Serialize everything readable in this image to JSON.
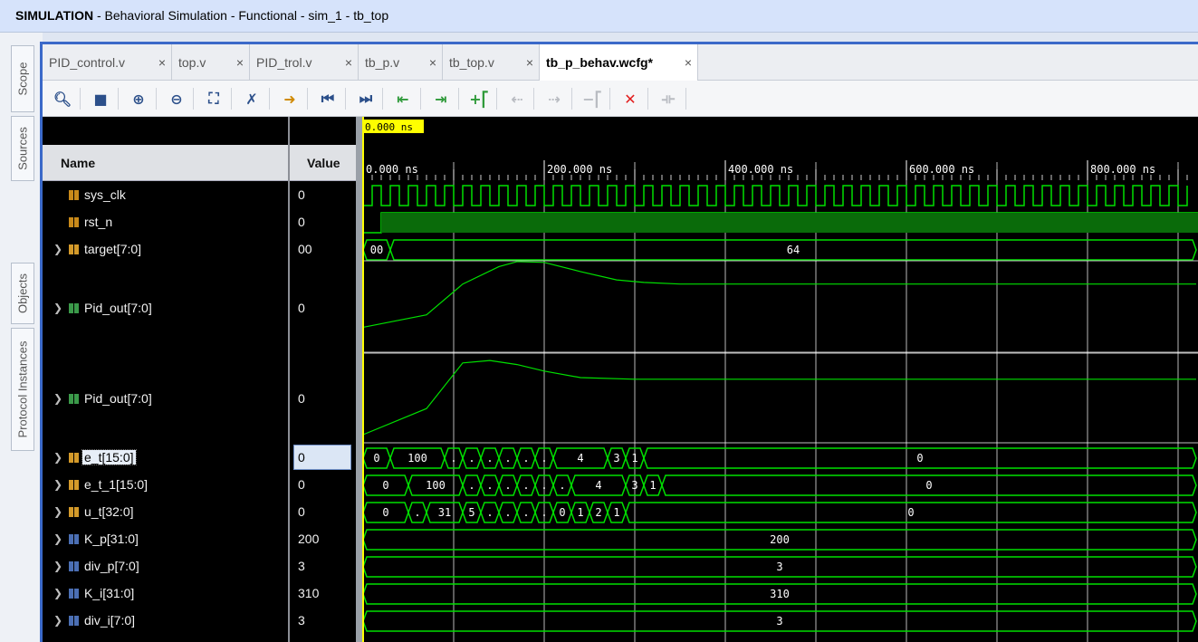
{
  "title": {
    "mode": "SIMULATION",
    "rest": " - Behavioral Simulation - Functional - sim_1 - tb_top"
  },
  "side_tabs": [
    "Scope",
    "Sources",
    "Objects",
    "Protocol Instances"
  ],
  "tabs": [
    {
      "label": "PID_control.v",
      "close": "×"
    },
    {
      "label": "top.v",
      "close": "×"
    },
    {
      "label": "PID_trol.v",
      "close": "×"
    },
    {
      "label": "tb_p.v",
      "close": "×"
    },
    {
      "label": "tb_top.v",
      "close": "×"
    },
    {
      "label": "tb_p_behav.wcfg*",
      "close": "×",
      "active": true
    }
  ],
  "toolbar": [
    {
      "name": "search-icon",
      "glyph": "🔍︎",
      "color": "#2b4f8a"
    },
    {
      "name": "save-icon",
      "glyph": "■",
      "color": "#2b4f8a"
    },
    {
      "name": "zoom-in-icon",
      "glyph": "⊕",
      "color": "#2b4f8a"
    },
    {
      "name": "zoom-out-icon",
      "glyph": "⊖",
      "color": "#2b4f8a"
    },
    {
      "name": "zoom-fit-icon",
      "glyph": "⛶",
      "color": "#2b4f8a"
    },
    {
      "name": "cursor-icon",
      "glyph": "✗",
      "color": "#2b4f8a"
    },
    {
      "name": "goto-cursor-icon",
      "glyph": "➜",
      "color": "#d08a00"
    },
    {
      "name": "go-to-start-icon",
      "glyph": "⏮",
      "color": "#2b4f8a"
    },
    {
      "name": "go-to-end-icon",
      "glyph": "⏭",
      "color": "#2b4f8a"
    },
    {
      "name": "previous-transition-icon",
      "glyph": "⇤",
      "color": "#2f9a3a"
    },
    {
      "name": "next-transition-icon",
      "glyph": "⇥",
      "color": "#2f9a3a"
    },
    {
      "name": "add-marker-icon",
      "glyph": "+⎡",
      "color": "#2f9a3a"
    },
    {
      "name": "previous-marker-icon",
      "glyph": "⇠",
      "color": "#b9bcc2"
    },
    {
      "name": "next-marker-icon",
      "glyph": "⇢",
      "color": "#b9bcc2"
    },
    {
      "name": "delete-marker-icon",
      "glyph": "−⎡",
      "color": "#b9bcc2"
    },
    {
      "name": "delete-icon",
      "glyph": "✕",
      "color": "#e21d1d"
    },
    {
      "name": "swap-cursors-icon",
      "glyph": "⟛",
      "color": "#b9bcc2"
    }
  ],
  "columns": {
    "name": "Name",
    "value": "Value"
  },
  "signals": [
    {
      "name": "sys_clk",
      "value": "0",
      "expandable": false,
      "icon": "bit"
    },
    {
      "name": "rst_n",
      "value": "0",
      "expandable": false,
      "icon": "bit"
    },
    {
      "name": "target[7:0]",
      "value": "00",
      "expandable": true,
      "icon": "bus-orange"
    },
    {
      "name": "Pid_out[7:0]",
      "value": "0",
      "expandable": true,
      "icon": "bus-green"
    },
    {
      "name": "Pid_out[7:0]",
      "value": "0",
      "expandable": true,
      "icon": "bus-green"
    },
    {
      "name": "e_t[15:0]",
      "value": "0",
      "expandable": true,
      "icon": "bus-orange",
      "selected": true
    },
    {
      "name": "e_t_1[15:0]",
      "value": "0",
      "expandable": true,
      "icon": "bus-orange"
    },
    {
      "name": "u_t[32:0]",
      "value": "0",
      "expandable": true,
      "icon": "bus-orange"
    },
    {
      "name": "K_p[31:0]",
      "value": "200",
      "expandable": true,
      "icon": "bus-blue"
    },
    {
      "name": "div_p[7:0]",
      "value": "3",
      "expandable": true,
      "icon": "bus-blue"
    },
    {
      "name": "K_i[31:0]",
      "value": "310",
      "expandable": true,
      "icon": "bus-blue"
    },
    {
      "name": "div_i[7:0]",
      "value": "3",
      "expandable": true,
      "icon": "bus-blue"
    }
  ],
  "waveform": {
    "cursor_label": "0.000 ns",
    "time_labels": [
      "0.000 ns",
      "200.000 ns",
      "400.000 ns",
      "600.000 ns",
      "800.000 ns"
    ],
    "time_range_ns": [
      0,
      920
    ],
    "clock_period_ns": 20,
    "rst_release_ns": 20,
    "colors": {
      "signal": "#00e000",
      "bus_fill": "#0a6b0a",
      "grid": "#ffffff",
      "cursor": "#ffff00",
      "text": "#ffffff"
    },
    "buses": {
      "target": [
        {
          "t0": 0,
          "t1": 30,
          "label": "00"
        },
        {
          "t0": 30,
          "t1": 920,
          "label": "64"
        }
      ],
      "e_t": [
        {
          "t0": 0,
          "t1": 30,
          "label": "0"
        },
        {
          "t0": 30,
          "t1": 90,
          "label": "100"
        },
        {
          "t0": 90,
          "t1": 110,
          "label": "."
        },
        {
          "t0": 110,
          "t1": 130,
          "label": "."
        },
        {
          "t0": 130,
          "t1": 150,
          "label": "."
        },
        {
          "t0": 150,
          "t1": 170,
          "label": "."
        },
        {
          "t0": 170,
          "t1": 190,
          "label": "."
        },
        {
          "t0": 190,
          "t1": 210,
          "label": "."
        },
        {
          "t0": 210,
          "t1": 270,
          "label": "4"
        },
        {
          "t0": 270,
          "t1": 290,
          "label": "3"
        },
        {
          "t0": 290,
          "t1": 310,
          "label": "1"
        },
        {
          "t0": 310,
          "t1": 920,
          "label": "0"
        }
      ],
      "e_t_1": [
        {
          "t0": 0,
          "t1": 50,
          "label": "0"
        },
        {
          "t0": 50,
          "t1": 110,
          "label": "100"
        },
        {
          "t0": 110,
          "t1": 130,
          "label": "."
        },
        {
          "t0": 130,
          "t1": 150,
          "label": "."
        },
        {
          "t0": 150,
          "t1": 170,
          "label": "."
        },
        {
          "t0": 170,
          "t1": 190,
          "label": "."
        },
        {
          "t0": 190,
          "t1": 210,
          "label": "."
        },
        {
          "t0": 210,
          "t1": 230,
          "label": "."
        },
        {
          "t0": 230,
          "t1": 290,
          "label": "4"
        },
        {
          "t0": 290,
          "t1": 310,
          "label": "3"
        },
        {
          "t0": 310,
          "t1": 330,
          "label": "1"
        },
        {
          "t0": 330,
          "t1": 920,
          "label": "0"
        }
      ],
      "u_t": [
        {
          "t0": 0,
          "t1": 50,
          "label": "0"
        },
        {
          "t0": 50,
          "t1": 70,
          "label": "."
        },
        {
          "t0": 70,
          "t1": 110,
          "label": "31"
        },
        {
          "t0": 110,
          "t1": 130,
          "label": "5"
        },
        {
          "t0": 130,
          "t1": 150,
          "label": "."
        },
        {
          "t0": 150,
          "t1": 170,
          "label": "."
        },
        {
          "t0": 170,
          "t1": 190,
          "label": "."
        },
        {
          "t0": 190,
          "t1": 210,
          "label": "."
        },
        {
          "t0": 210,
          "t1": 230,
          "label": "0"
        },
        {
          "t0": 230,
          "t1": 250,
          "label": "1"
        },
        {
          "t0": 250,
          "t1": 270,
          "label": "2"
        },
        {
          "t0": 270,
          "t1": 290,
          "label": "1"
        },
        {
          "t0": 290,
          "t1": 920,
          "label": "0"
        }
      ],
      "K_p": [
        {
          "t0": 0,
          "t1": 920,
          "label": "200"
        }
      ],
      "div_p": [
        {
          "t0": 0,
          "t1": 920,
          "label": "3"
        }
      ],
      "K_i": [
        {
          "t0": 0,
          "t1": 920,
          "label": "310"
        }
      ],
      "div_i": [
        {
          "t0": 0,
          "t1": 920,
          "label": "3"
        }
      ]
    },
    "analog1": [
      [
        0,
        30
      ],
      [
        70,
        45
      ],
      [
        110,
        82
      ],
      [
        150,
        103
      ],
      [
        170,
        109
      ],
      [
        200,
        108
      ],
      [
        240,
        97
      ],
      [
        280,
        87
      ],
      [
        310,
        84
      ],
      [
        350,
        82
      ],
      [
        400,
        82
      ],
      [
        920,
        82
      ]
    ],
    "analog2": [
      [
        0,
        10
      ],
      [
        70,
        42
      ],
      [
        110,
        98
      ],
      [
        140,
        101
      ],
      [
        170,
        96
      ],
      [
        200,
        88
      ],
      [
        240,
        80
      ],
      [
        300,
        78
      ],
      [
        920,
        78
      ]
    ]
  }
}
